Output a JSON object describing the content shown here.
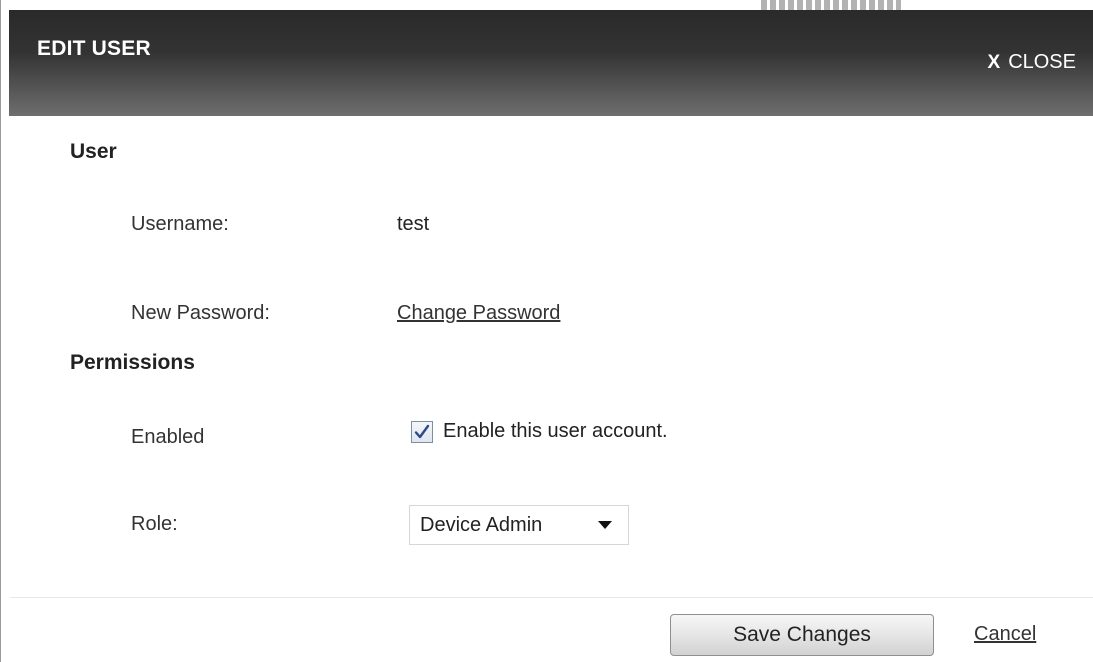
{
  "dialog": {
    "title": "EDIT USER",
    "close_x": "X",
    "close_label": "CLOSE"
  },
  "user_section": {
    "heading": "User",
    "username_label": "Username:",
    "username_value": "test",
    "password_label": "New Password:",
    "password_link": "Change Password"
  },
  "permissions_section": {
    "heading": "Permissions",
    "enabled_label": "Enabled",
    "enabled_checked": true,
    "enabled_checkbox_label": "Enable this user account.",
    "role_label": "Role:",
    "role_selected": "Device Admin"
  },
  "footer": {
    "save_label": "Save Changes",
    "cancel_label": "Cancel"
  },
  "icons": {
    "close": "close-icon",
    "checkbox": "checkmark-icon",
    "dropdown": "chevron-down-icon"
  },
  "colors": {
    "titlebar_dark": "#2a2a2a",
    "titlebar_light": "#6e6e6e",
    "checkmark": "#2b4a8a"
  }
}
